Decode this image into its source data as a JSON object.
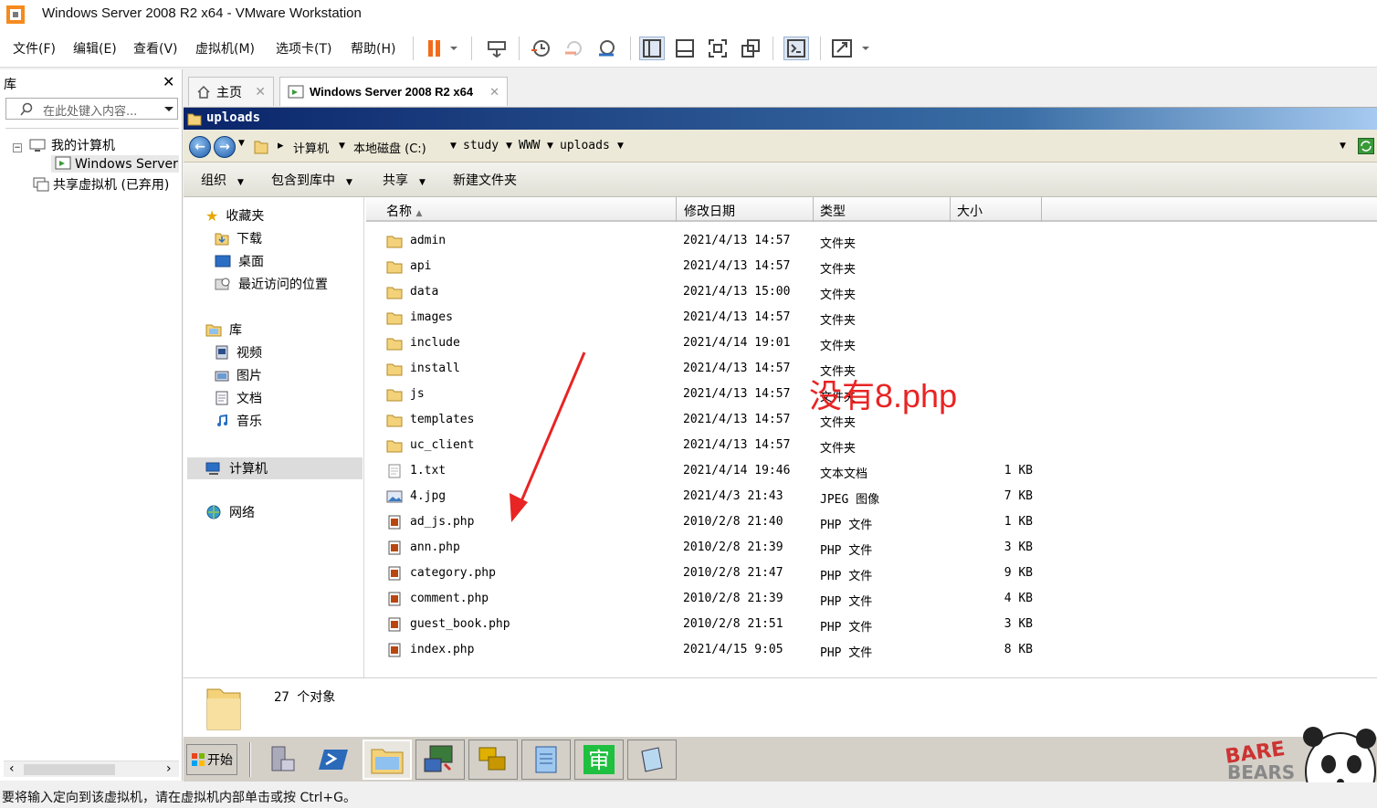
{
  "window": {
    "title": "Windows Server 2008 R2 x64 - VMware Workstation"
  },
  "menu": [
    "文件(F)",
    "编辑(E)",
    "查看(V)",
    "虚拟机(M)",
    "选项卡(T)",
    "帮助(H)"
  ],
  "library": {
    "title": "库",
    "search_placeholder": "在此处键入内容...",
    "tree": [
      "我的计算机",
      "Windows Server",
      "共享虚拟机 (已弃用)"
    ]
  },
  "tabs": [
    {
      "label": "主页"
    },
    {
      "label": "Windows Server 2008 R2 x64"
    }
  ],
  "explorer": {
    "title": "uploads",
    "breadcrumb": [
      "计算机",
      "本地磁盘 (C:)",
      "study",
      "WWW",
      "uploads"
    ],
    "commands": [
      "组织",
      "包含到库中",
      "共享",
      "新建文件夹"
    ],
    "nav": {
      "favorites": "收藏夹",
      "favorites_items": [
        "下载",
        "桌面",
        "最近访问的位置"
      ],
      "libraries": "库",
      "libraries_items": [
        "视频",
        "图片",
        "文档",
        "音乐"
      ],
      "computer": "计算机",
      "network": "网络"
    },
    "columns": [
      "名称",
      "修改日期",
      "类型",
      "大小"
    ],
    "files": [
      {
        "name": "admin",
        "date": "2021/4/13 14:57",
        "type": "文件夹",
        "size": "",
        "kind": "folder"
      },
      {
        "name": "api",
        "date": "2021/4/13 14:57",
        "type": "文件夹",
        "size": "",
        "kind": "folder"
      },
      {
        "name": "data",
        "date": "2021/4/13 15:00",
        "type": "文件夹",
        "size": "",
        "kind": "folder"
      },
      {
        "name": "images",
        "date": "2021/4/13 14:57",
        "type": "文件夹",
        "size": "",
        "kind": "folder"
      },
      {
        "name": "include",
        "date": "2021/4/14 19:01",
        "type": "文件夹",
        "size": "",
        "kind": "folder"
      },
      {
        "name": "install",
        "date": "2021/4/13 14:57",
        "type": "文件夹",
        "size": "",
        "kind": "folder"
      },
      {
        "name": "js",
        "date": "2021/4/13 14:57",
        "type": "文件夹",
        "size": "",
        "kind": "folder"
      },
      {
        "name": "templates",
        "date": "2021/4/13 14:57",
        "type": "文件夹",
        "size": "",
        "kind": "folder"
      },
      {
        "name": "uc_client",
        "date": "2021/4/13 14:57",
        "type": "文件夹",
        "size": "",
        "kind": "folder"
      },
      {
        "name": "1.txt",
        "date": "2021/4/14 19:46",
        "type": "文本文档",
        "size": "1 KB",
        "kind": "txt"
      },
      {
        "name": "4.jpg",
        "date": "2021/4/3 21:43",
        "type": "JPEG 图像",
        "size": "7 KB",
        "kind": "jpg"
      },
      {
        "name": "ad_js.php",
        "date": "2010/2/8 21:40",
        "type": "PHP 文件",
        "size": "1 KB",
        "kind": "php"
      },
      {
        "name": "ann.php",
        "date": "2010/2/8 21:39",
        "type": "PHP 文件",
        "size": "3 KB",
        "kind": "php"
      },
      {
        "name": "category.php",
        "date": "2010/2/8 21:47",
        "type": "PHP 文件",
        "size": "9 KB",
        "kind": "php"
      },
      {
        "name": "comment.php",
        "date": "2010/2/8 21:39",
        "type": "PHP 文件",
        "size": "4 KB",
        "kind": "php"
      },
      {
        "name": "guest_book.php",
        "date": "2010/2/8 21:51",
        "type": "PHP 文件",
        "size": "3 KB",
        "kind": "php"
      },
      {
        "name": "index.php",
        "date": "2021/4/15 9:05",
        "type": "PHP 文件",
        "size": "8 KB",
        "kind": "php"
      }
    ],
    "object_count": "27 个对象"
  },
  "taskbar": {
    "start_label": "开始"
  },
  "annotation": {
    "text": "没有8.php",
    "color": "#e82424"
  },
  "status": {
    "message": "要将输入定向到该虚拟机，请在虚拟机内部单击或按 Ctrl+G。"
  }
}
